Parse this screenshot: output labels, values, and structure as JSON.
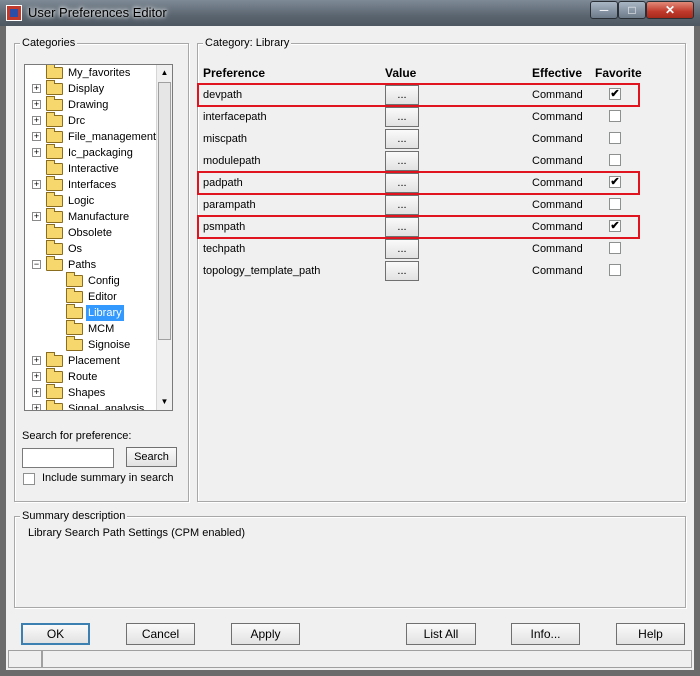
{
  "window": {
    "title": "User Preferences Editor"
  },
  "categories": {
    "label": "Categories",
    "tree": [
      {
        "label": "My_favorites",
        "level": 0,
        "expander": ""
      },
      {
        "label": "Display",
        "level": 0,
        "expander": "+"
      },
      {
        "label": "Drawing",
        "level": 0,
        "expander": "+"
      },
      {
        "label": "Drc",
        "level": 0,
        "expander": "+"
      },
      {
        "label": "File_management",
        "level": 0,
        "expander": "+"
      },
      {
        "label": "Ic_packaging",
        "level": 0,
        "expander": "+"
      },
      {
        "label": "Interactive",
        "level": 0,
        "expander": ""
      },
      {
        "label": "Interfaces",
        "level": 0,
        "expander": "+"
      },
      {
        "label": "Logic",
        "level": 0,
        "expander": ""
      },
      {
        "label": "Manufacture",
        "level": 0,
        "expander": "+"
      },
      {
        "label": "Obsolete",
        "level": 0,
        "expander": ""
      },
      {
        "label": "Os",
        "level": 0,
        "expander": ""
      },
      {
        "label": "Paths",
        "level": 0,
        "expander": "-"
      },
      {
        "label": "Config",
        "level": 1,
        "expander": ""
      },
      {
        "label": "Editor",
        "level": 1,
        "expander": ""
      },
      {
        "label": "Library",
        "level": 1,
        "expander": "",
        "selected": true
      },
      {
        "label": "MCM",
        "level": 1,
        "expander": ""
      },
      {
        "label": "Signoise",
        "level": 1,
        "expander": ""
      },
      {
        "label": "Placement",
        "level": 0,
        "expander": "+"
      },
      {
        "label": "Route",
        "level": 0,
        "expander": "+"
      },
      {
        "label": "Shapes",
        "level": 0,
        "expander": "+"
      },
      {
        "label": "Signal_analysis",
        "level": 0,
        "expander": "+"
      }
    ],
    "search_label": "Search for preference:",
    "search_value": "",
    "search_button": "Search",
    "include_summary": "Include summary in search",
    "include_summary_checked": false
  },
  "category_panel": {
    "label": "Category:  Library",
    "headers": {
      "preference": "Preference",
      "value": "Value",
      "effective": "Effective",
      "favorite": "Favorite"
    },
    "rows": [
      {
        "name": "devpath",
        "value_button": "...",
        "effective": "Command",
        "favorite": true,
        "highlighted": true
      },
      {
        "name": "interfacepath",
        "value_button": "...",
        "effective": "Command",
        "favorite": false,
        "highlighted": false
      },
      {
        "name": "miscpath",
        "value_button": "...",
        "effective": "Command",
        "favorite": false,
        "highlighted": false
      },
      {
        "name": "modulepath",
        "value_button": "...",
        "effective": "Command",
        "favorite": false,
        "highlighted": false
      },
      {
        "name": "padpath",
        "value_button": "...",
        "effective": "Command",
        "favorite": true,
        "highlighted": true
      },
      {
        "name": "parampath",
        "value_button": "...",
        "effective": "Command",
        "favorite": false,
        "highlighted": false
      },
      {
        "name": "psmpath",
        "value_button": "...",
        "effective": "Command",
        "favorite": true,
        "highlighted": true
      },
      {
        "name": "techpath",
        "value_button": "...",
        "effective": "Command",
        "favorite": false,
        "highlighted": false
      },
      {
        "name": "topology_template_path",
        "value_button": "...",
        "effective": "Command",
        "favorite": false,
        "highlighted": false
      }
    ]
  },
  "summary": {
    "label": "Summary description",
    "text": "Library Search Path Settings (CPM enabled)"
  },
  "buttons": {
    "ok": "OK",
    "cancel": "Cancel",
    "apply": "Apply",
    "list_all": "List All",
    "info": "Info...",
    "help": "Help"
  },
  "colors": {
    "highlight": "#e0141e",
    "selection": "#3399ff",
    "dialog_bg": "#f0f0f0",
    "folder": "#f5d76e"
  },
  "icons": {
    "check": "✔",
    "plus": "+",
    "minus": "−",
    "scroll_up": "▲",
    "scroll_down": "▼",
    "minimize": "─",
    "maximize": "□",
    "close": "✕"
  }
}
